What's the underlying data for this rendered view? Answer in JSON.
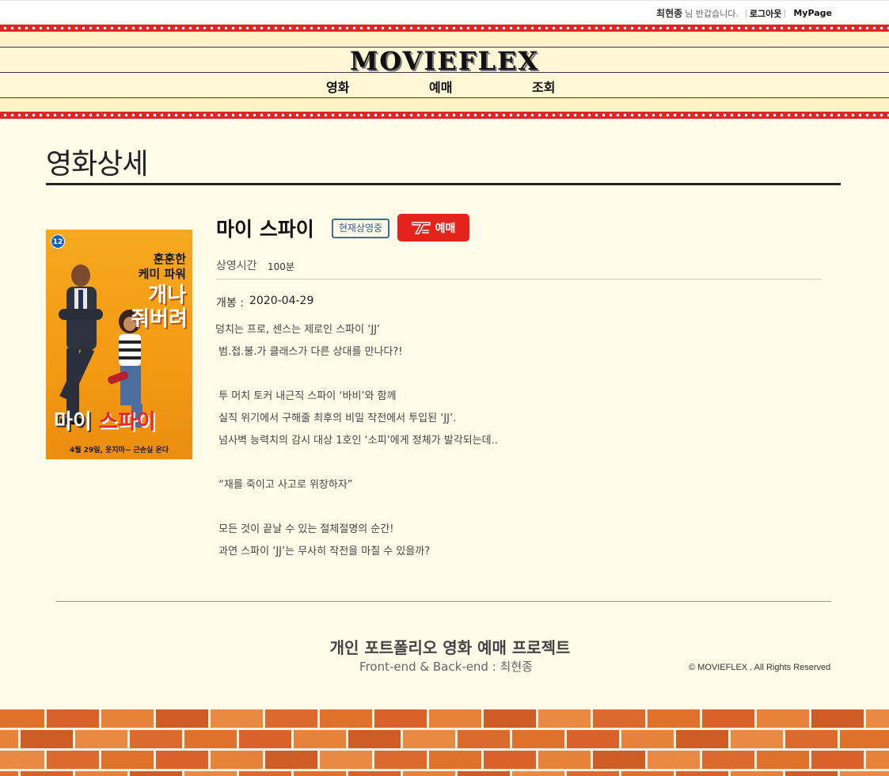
{
  "user_bar": {
    "user_name": "최현종",
    "greeting": "님 반갑습니다.",
    "logout_label": "로그아웃",
    "mypage_label": "MyPage"
  },
  "header": {
    "logo": "MOVIEFLEX",
    "nav": [
      "영화",
      "예매",
      "조회"
    ]
  },
  "page": {
    "title": "영화상세"
  },
  "movie": {
    "title": "마이 스파이",
    "status_badge": "현재상영중",
    "book_label": "예매",
    "runtime_label": "상영시간",
    "runtime_value": "100분",
    "open_label": "개봉 :",
    "open_value": "2020-04-29",
    "poster": {
      "age_rating": "12",
      "copy_line1": "훈훈한\n케미 파워",
      "copy_line2": "개나\n줘버려",
      "title_left": "마이",
      "title_right": "스파이",
      "release_text": "4월 29일, 웃지마~ 근손실 온다"
    },
    "synopsis": [
      "덩치는 프로, 센스는 제로인 스파이 ‘JJ’",
      " 범.접.불.가 클래스가 다른 상대를 만나다?!",
      "",
      " 투 머치 토커 내근직 스파이 ‘바비’와 함께",
      " 실직 위기에서 구해줄 최후의 비밀 작전에서 투입된 ‘JJ’.",
      " 넘사벽 능력치의 감시 대상 1호인 ‘소피’에게 정체가 발각되는데..",
      "",
      " “재를 죽이고 사고로 위장하자”",
      "",
      " 모든 것이 끝날 수 있는 절체절명의 순간!",
      " 과연 스파이 ‘JJ’는 무사히 작전을 마칠 수 있을까?"
    ]
  },
  "footer": {
    "title": "개인 포트폴리오 영화 예매 프로젝트",
    "credit": "Front-end & Back-end : 최현종",
    "copyright": "© MOVIEFLEX . All Rights Reserved"
  },
  "colors": {
    "background": "#fffbe9",
    "marquee_red": "#e12426",
    "book_button": "#e3231c",
    "badge_border": "#3a6ea5",
    "brick": "#e0712a"
  }
}
